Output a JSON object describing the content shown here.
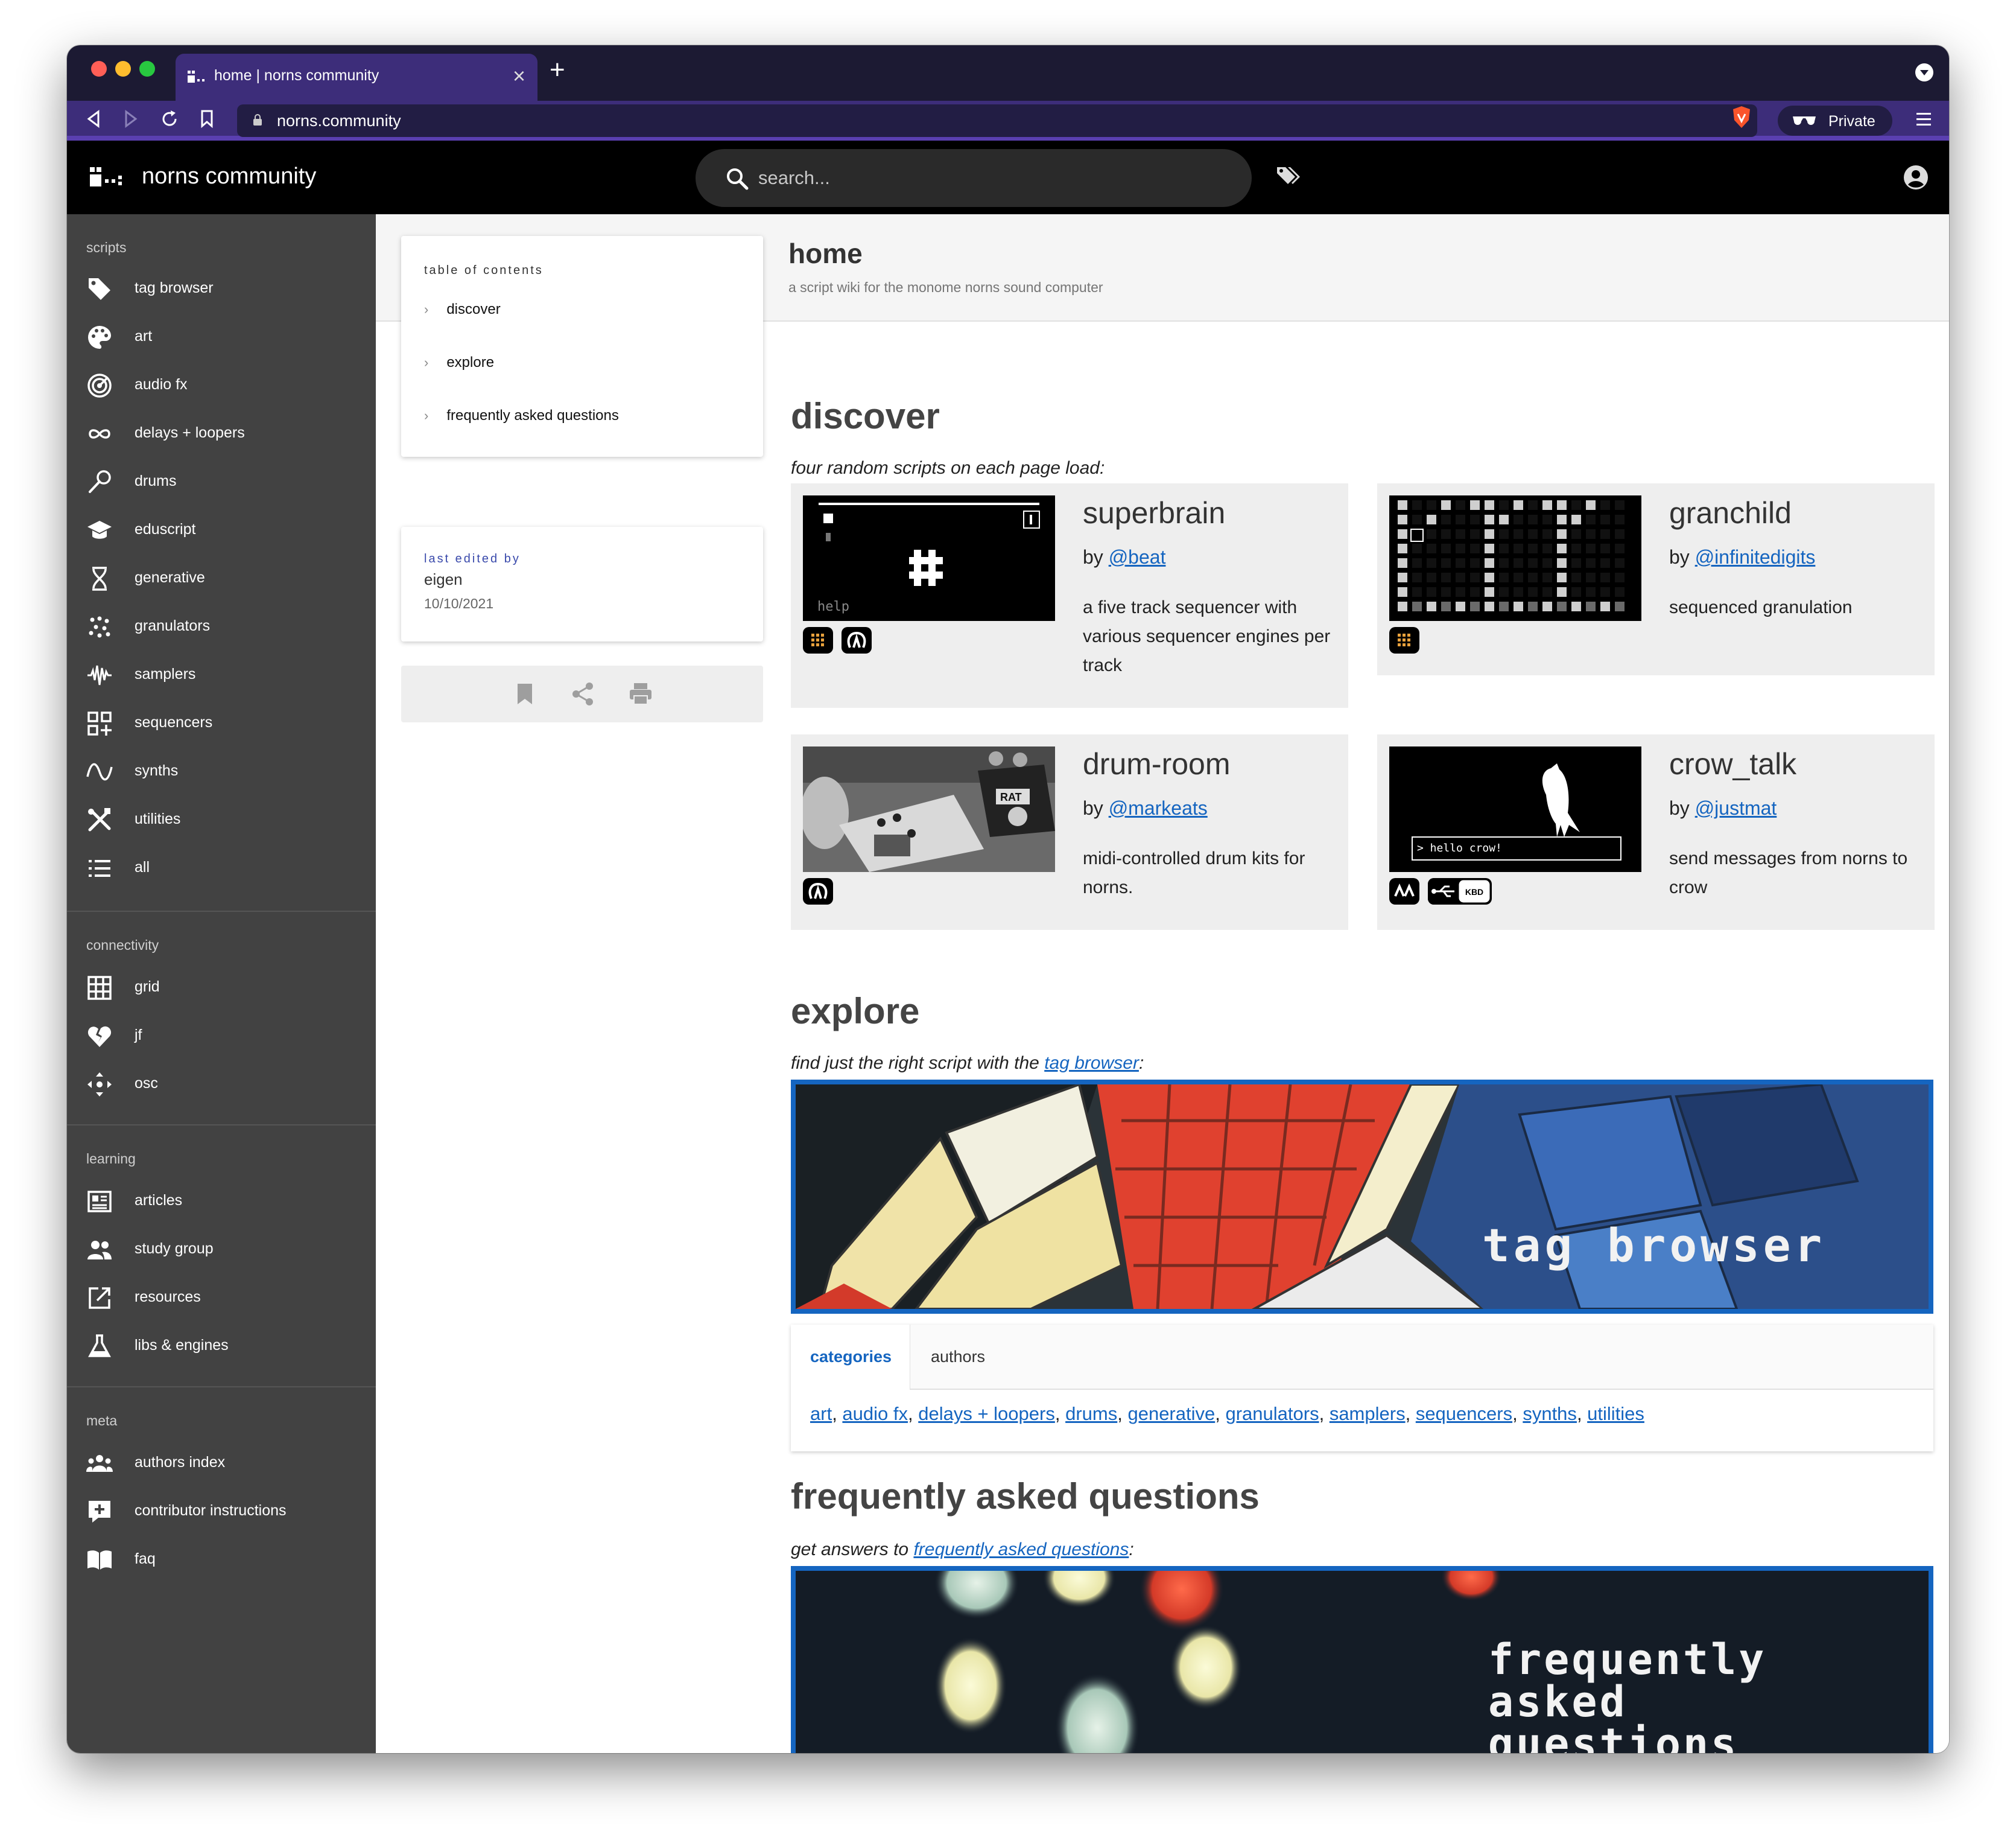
{
  "browser": {
    "tab_title": "home | norns community",
    "new_tab": "+",
    "close": "×",
    "url": "norns.community",
    "private_label": "Private"
  },
  "header": {
    "site_title": "norns community",
    "search_placeholder": "search..."
  },
  "sidebar": {
    "sections": [
      {
        "title": "scripts",
        "items": [
          {
            "label": "tag browser",
            "icon": "tag-icon"
          },
          {
            "label": "art",
            "icon": "palette-icon"
          },
          {
            "label": "audio fx",
            "icon": "radar-icon"
          },
          {
            "label": "delays + loopers",
            "icon": "infinity-icon"
          },
          {
            "label": "drums",
            "icon": "drumstick-icon"
          },
          {
            "label": "eduscript",
            "icon": "school-icon"
          },
          {
            "label": "generative",
            "icon": "dna-icon"
          },
          {
            "label": "granulators",
            "icon": "scatter-icon"
          },
          {
            "label": "samplers",
            "icon": "waveform-icon"
          },
          {
            "label": "sequencers",
            "icon": "grid-plus-icon"
          },
          {
            "label": "synths",
            "icon": "sine-wave-icon"
          },
          {
            "label": "utilities",
            "icon": "tools-icon"
          },
          {
            "label": "all",
            "icon": "list-icon"
          }
        ]
      },
      {
        "title": "connectivity",
        "items": [
          {
            "label": "grid",
            "icon": "grid-icon"
          },
          {
            "label": "jf",
            "icon": "broken-heart-icon"
          },
          {
            "label": "osc",
            "icon": "arrows-icon"
          }
        ]
      },
      {
        "title": "learning",
        "items": [
          {
            "label": "articles",
            "icon": "newspaper-icon"
          },
          {
            "label": "study group",
            "icon": "people-icon"
          },
          {
            "label": "resources",
            "icon": "external-link-icon"
          },
          {
            "label": "libs & engines",
            "icon": "flask-icon"
          }
        ]
      },
      {
        "title": "meta",
        "items": [
          {
            "label": "authors index",
            "icon": "group-icon"
          },
          {
            "label": "contributor instructions",
            "icon": "comment-plus-icon"
          },
          {
            "label": "faq",
            "icon": "book-icon"
          }
        ]
      }
    ]
  },
  "page": {
    "title": "home",
    "subtitle": "a script wiki for the monome norns sound computer"
  },
  "toc": {
    "title": "table of contents",
    "items": [
      "discover",
      "explore",
      "frequently asked questions"
    ]
  },
  "last_edited": {
    "label": "last edited by",
    "name": "eigen",
    "date": "10/10/2021"
  },
  "discover": {
    "heading": "discover",
    "lead": "four random scripts on each page load:",
    "scripts": [
      {
        "name": "superbrain",
        "by": "by",
        "author": "@beat",
        "desc": "a five track sequencer with various sequencer engines per track",
        "thumb_text": "help",
        "badges": [
          "grid-badge",
          "midi-badge"
        ]
      },
      {
        "name": "granchild",
        "by": "by",
        "author": "@infinitedigits",
        "desc": "sequenced granulation",
        "badges": [
          "grid-badge"
        ]
      },
      {
        "name": "drum-room",
        "by": "by",
        "author": "@markeats",
        "desc": "midi-controlled drum kits for norns.",
        "thumb_text": "RAT",
        "badges": [
          "midi-badge"
        ]
      },
      {
        "name": "crow_talk",
        "by": "by",
        "author": "@justmat",
        "desc": "send messages from norns to crow",
        "thumb_text": "> hello crow!",
        "badges": [
          "crow-badge",
          "usb-badge",
          "keyboard-badge"
        ]
      }
    ]
  },
  "explore": {
    "heading": "explore",
    "lead_prefix": "find just the right script with the ",
    "lead_link": "tag browser",
    "lead_suffix": ":",
    "banner_text": "tag browser",
    "tabs": [
      "categories",
      "authors"
    ],
    "categories": [
      "art",
      "audio fx",
      "delays + loopers",
      "drums",
      "generative",
      "granulators",
      "samplers",
      "sequencers",
      "synths",
      "utilities"
    ]
  },
  "faq": {
    "heading": "frequently asked questions",
    "lead_prefix": "get answers to ",
    "lead_link": "frequently asked questions",
    "lead_suffix": ":",
    "banner_lines": [
      "frequently",
      "asked",
      "questions"
    ]
  },
  "colors": {
    "tabbar": "#1c1a33",
    "urlbar": "#3d2d7a",
    "sidebar": "#424242",
    "link": "#1565c0"
  }
}
